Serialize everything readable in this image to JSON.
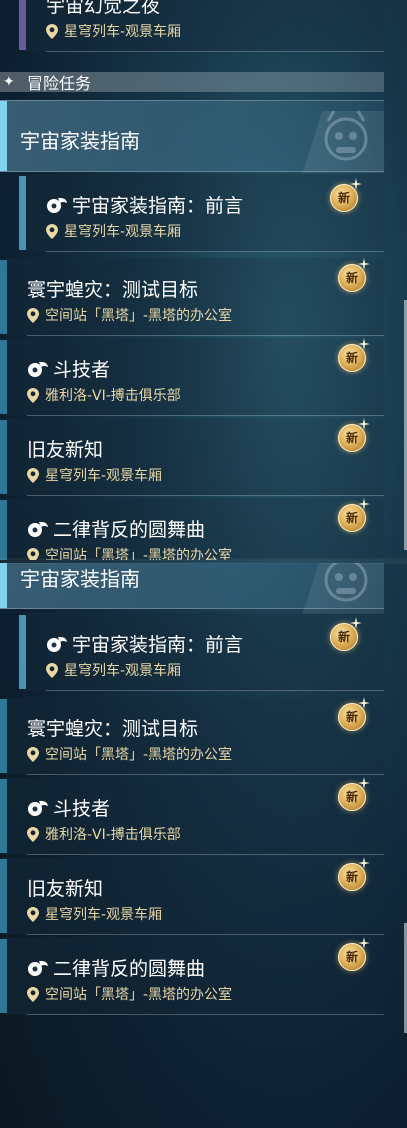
{
  "top": {
    "partial_quest": {
      "name": "宇宙幻觉之夜",
      "location": "星穹列车-观景车厢"
    },
    "section_header": {
      "title": "冒险任务"
    },
    "category": {
      "label": "宇宙家装指南"
    },
    "quests": [
      {
        "name": "宇宙家装指南：前言",
        "location": "星穹列车-观景车厢",
        "icon": "disc-icon",
        "badge": "新"
      },
      {
        "name": "寰宇蝗灾：测试目标",
        "location": "空间站「黑塔」-黑塔的办公室",
        "icon": "",
        "badge": "新"
      },
      {
        "name": "斗技者",
        "location": "雅利洛-VI-搏击俱乐部",
        "icon": "disc-icon",
        "badge": "新"
      },
      {
        "name": "旧友新知",
        "location": "星穹列车-观景车厢",
        "icon": "",
        "badge": "新"
      },
      {
        "name": "二律背反的圆舞曲",
        "location": "空间站「黑塔」-黑塔的办公室",
        "icon": "disc-icon",
        "badge": "新"
      }
    ]
  },
  "bottom": {
    "category": {
      "label": "宇宙家装指南"
    },
    "quests": [
      {
        "name": "宇宙家装指南：前言",
        "location": "星穹列车-观景车厢",
        "icon": "disc-icon",
        "badge": "新"
      },
      {
        "name": "寰宇蝗灾：测试目标",
        "location": "空间站「黑塔」-黑塔的办公室",
        "icon": "",
        "badge": "新"
      },
      {
        "name": "斗技者",
        "location": "雅利洛-VI-搏击俱乐部",
        "icon": "disc-icon",
        "badge": "新"
      },
      {
        "name": "旧友新知",
        "location": "星穹列车-观景车厢",
        "icon": "",
        "badge": "新"
      },
      {
        "name": "二律背反的圆舞曲",
        "location": "空间站「黑塔」-黑塔的办公室",
        "icon": "disc-icon",
        "badge": "新"
      }
    ]
  },
  "colors": {
    "accent_cyan": "#7fd6ea",
    "location_text": "#e9d7a5",
    "badge_gold": "#e1b35d"
  }
}
